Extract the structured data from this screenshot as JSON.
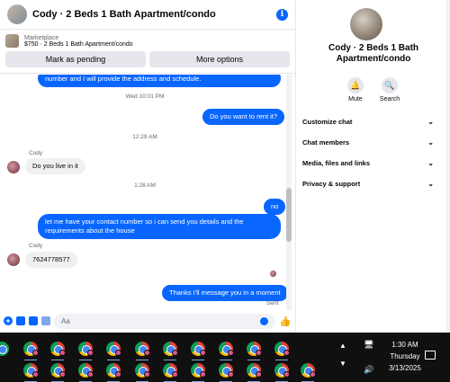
{
  "header": {
    "title": "Cody · 2 Beds 1 Bath Apartment/condo",
    "info_icon": "i"
  },
  "marketplace": {
    "category": "Marketplace",
    "item": "$750 · 2 Beds 1 Bath Apartment/condo",
    "mark_pending_label": "Mark as pending",
    "more_options_label": "More options"
  },
  "messages": {
    "m0": "number and I will provide the address and schedule.",
    "t1": "Wed 10:01 PM",
    "m1": "Do you want to rent it?",
    "t2": "12:29 AM",
    "s1": "Cody",
    "m2": "Do you live in it",
    "t3": "1:28 AM",
    "m3": "no",
    "m4": "let me have your contact number so i can send you details and the requirements about the house",
    "s2": "Cody",
    "m5": "7624778577",
    "m6": "Thanks I'll message you in a moment",
    "status": "Sent"
  },
  "composer": {
    "placeholder": "Aa"
  },
  "details": {
    "name": "Cody · 2 Beds 1 Bath Apartment/condo",
    "mute_label": "Mute",
    "search_label": "Search",
    "sections": [
      "Customize chat",
      "Chat members",
      "Media, files and links",
      "Privacy & support"
    ]
  },
  "taskbar": {
    "time": "1:30 AM",
    "day": "Thursday",
    "date": "3/13/2025"
  },
  "colors": {
    "accent": "#0866ff",
    "bubble_in": "#f0f0f0",
    "taskbar": "#101010"
  }
}
